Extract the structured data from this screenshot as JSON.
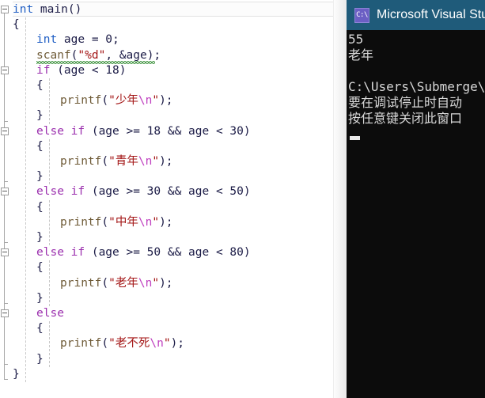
{
  "editor": {
    "name": "code-editor",
    "language": "c",
    "lines": [
      {
        "indent": 0,
        "tokens": [
          {
            "t": "int",
            "c": "kw-type"
          },
          {
            "t": " main()",
            "c": "plain"
          }
        ]
      },
      {
        "indent": 0,
        "tokens": [
          {
            "t": "{",
            "c": "plain"
          }
        ]
      },
      {
        "indent": 1,
        "tokens": [
          {
            "t": "int",
            "c": "kw-type"
          },
          {
            "t": " age = 0;",
            "c": "plain"
          }
        ]
      },
      {
        "indent": 1,
        "tokens": [
          {
            "t": "scanf",
            "c": "fn"
          },
          {
            "t": "(",
            "c": "plain"
          },
          {
            "t": "\"%d\"",
            "c": "str"
          },
          {
            "t": ", &age);",
            "c": "plain"
          }
        ]
      },
      {
        "indent": 1,
        "tokens": [
          {
            "t": "if",
            "c": "kw-ctrl"
          },
          {
            "t": " (age < 18)",
            "c": "plain"
          }
        ]
      },
      {
        "indent": 1,
        "tokens": [
          {
            "t": "{",
            "c": "plain"
          }
        ]
      },
      {
        "indent": 2,
        "tokens": [
          {
            "t": "printf",
            "c": "fn"
          },
          {
            "t": "(",
            "c": "plain"
          },
          {
            "t": "\"少年",
            "c": "str"
          },
          {
            "t": "\\n",
            "c": "esc"
          },
          {
            "t": "\"",
            "c": "str"
          },
          {
            "t": ");",
            "c": "plain"
          }
        ]
      },
      {
        "indent": 1,
        "tokens": [
          {
            "t": "}",
            "c": "plain"
          }
        ]
      },
      {
        "indent": 1,
        "tokens": [
          {
            "t": "else if",
            "c": "kw-ctrl"
          },
          {
            "t": " (age >= 18 && age < 30)",
            "c": "plain"
          }
        ]
      },
      {
        "indent": 1,
        "tokens": [
          {
            "t": "{",
            "c": "plain"
          }
        ]
      },
      {
        "indent": 2,
        "tokens": [
          {
            "t": "printf",
            "c": "fn"
          },
          {
            "t": "(",
            "c": "plain"
          },
          {
            "t": "\"青年",
            "c": "str"
          },
          {
            "t": "\\n",
            "c": "esc"
          },
          {
            "t": "\"",
            "c": "str"
          },
          {
            "t": ");",
            "c": "plain"
          }
        ]
      },
      {
        "indent": 1,
        "tokens": [
          {
            "t": "}",
            "c": "plain"
          }
        ]
      },
      {
        "indent": 1,
        "tokens": [
          {
            "t": "else if",
            "c": "kw-ctrl"
          },
          {
            "t": " (age >= 30 && age < 50)",
            "c": "plain"
          }
        ]
      },
      {
        "indent": 1,
        "tokens": [
          {
            "t": "{",
            "c": "plain"
          }
        ]
      },
      {
        "indent": 2,
        "tokens": [
          {
            "t": "printf",
            "c": "fn"
          },
          {
            "t": "(",
            "c": "plain"
          },
          {
            "t": "\"中年",
            "c": "str"
          },
          {
            "t": "\\n",
            "c": "esc"
          },
          {
            "t": "\"",
            "c": "str"
          },
          {
            "t": ");",
            "c": "plain"
          }
        ]
      },
      {
        "indent": 1,
        "tokens": [
          {
            "t": "}",
            "c": "plain"
          }
        ]
      },
      {
        "indent": 1,
        "tokens": [
          {
            "t": "else if",
            "c": "kw-ctrl"
          },
          {
            "t": " (age >= 50 && age < 80)",
            "c": "plain"
          }
        ]
      },
      {
        "indent": 1,
        "tokens": [
          {
            "t": "{",
            "c": "plain"
          }
        ]
      },
      {
        "indent": 2,
        "tokens": [
          {
            "t": "printf",
            "c": "fn"
          },
          {
            "t": "(",
            "c": "plain"
          },
          {
            "t": "\"老年",
            "c": "str"
          },
          {
            "t": "\\n",
            "c": "esc"
          },
          {
            "t": "\"",
            "c": "str"
          },
          {
            "t": ");",
            "c": "plain"
          }
        ]
      },
      {
        "indent": 1,
        "tokens": [
          {
            "t": "}",
            "c": "plain"
          }
        ]
      },
      {
        "indent": 1,
        "tokens": [
          {
            "t": "else",
            "c": "kw-ctrl"
          }
        ]
      },
      {
        "indent": 1,
        "tokens": [
          {
            "t": "{",
            "c": "plain"
          }
        ]
      },
      {
        "indent": 2,
        "tokens": [
          {
            "t": "printf",
            "c": "fn"
          },
          {
            "t": "(",
            "c": "plain"
          },
          {
            "t": "\"老不死",
            "c": "str"
          },
          {
            "t": "\\n",
            "c": "esc"
          },
          {
            "t": "\"",
            "c": "str"
          },
          {
            "t": ");",
            "c": "plain"
          }
        ]
      },
      {
        "indent": 1,
        "tokens": [
          {
            "t": "}",
            "c": "plain"
          }
        ]
      },
      {
        "indent": 0,
        "tokens": [
          {
            "t": "}",
            "c": "plain"
          }
        ]
      }
    ],
    "fold_markers": [
      {
        "line": 0
      },
      {
        "line": 4
      },
      {
        "line": 8
      },
      {
        "line": 12
      },
      {
        "line": 16
      },
      {
        "line": 20
      }
    ],
    "error_squiggle": {
      "line": 3,
      "label": "scanf-unsafe-warning"
    },
    "colors": {
      "keyword_type": "#1f5ec4",
      "keyword_control": "#9b2fae",
      "function": "#6e5a36",
      "string": "#a31515",
      "escape": "#bf3fbf",
      "plain": "#1b1b46",
      "squiggle": "#4f9d4f",
      "background": "#ffffff"
    }
  },
  "console": {
    "title": "Microsoft Visual Stu",
    "icon": "console-window-icon",
    "icon_glyph": "C:\\",
    "titlebar_color": "#1f5b7a",
    "background": "#0c0c0c",
    "text_color": "#d8d8d8",
    "lines": [
      "55",
      "老年",
      "",
      "C:\\Users\\Submerge\\",
      "要在调试停止时自动",
      "按任意键关闭此窗口"
    ],
    "cursor": "block-cursor"
  }
}
